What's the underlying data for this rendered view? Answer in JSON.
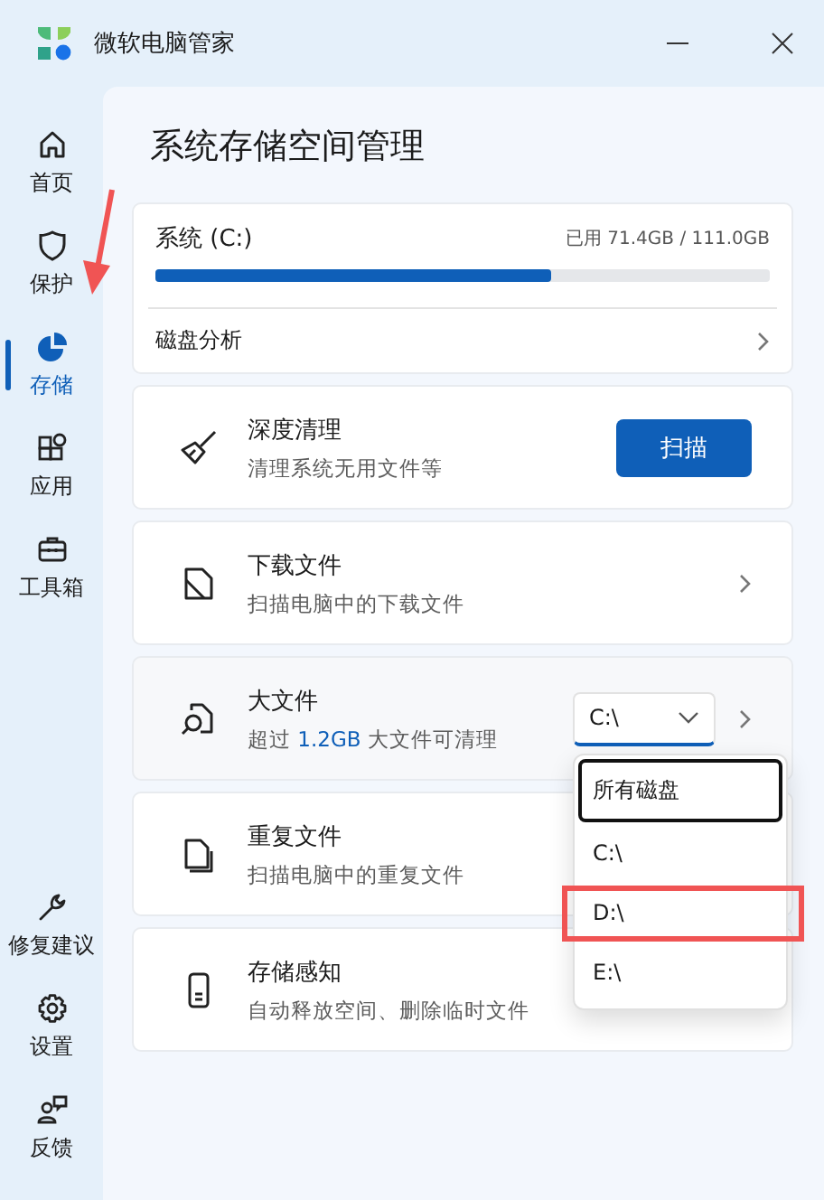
{
  "window": {
    "title": "微软电脑管家"
  },
  "sidebar": {
    "items": [
      {
        "label": "首页",
        "selected": false
      },
      {
        "label": "保护",
        "selected": false
      },
      {
        "label": "存储",
        "selected": true
      },
      {
        "label": "应用",
        "selected": false
      },
      {
        "label": "工具箱",
        "selected": false
      }
    ],
    "bottom_items": [
      {
        "label": "修复建议",
        "selected": false
      },
      {
        "label": "设置",
        "selected": false
      },
      {
        "label": "反馈",
        "selected": false
      }
    ]
  },
  "page_title": "系统存储空间管理",
  "disk": {
    "name": "系统 (C:)",
    "usage": "已用 71.4GB / 111.0GB",
    "level": 0.643,
    "link": "磁盘分析"
  },
  "cards": [
    {
      "kind": "button",
      "title": "深度清理",
      "subtitle": "清理系统无用文件等",
      "button": "扫描"
    },
    {
      "kind": "chevron",
      "title": "下载文件",
      "subtitle": "扫描电脑中的下载文件"
    },
    {
      "kind": "dropdown",
      "title": "大文件",
      "subtitle": "超过 *1.2GB* 大文件可清理",
      "value": "C:\\",
      "menu": [
        {
          "label": "所有磁盘",
          "focused": true
        },
        {
          "label": "C:\\",
          "focused": false
        },
        {
          "label": "D:\\",
          "focused": false
        },
        {
          "label": "E:\\",
          "focused": false
        }
      ]
    },
    {
      "kind": "plain",
      "title": "重复文件",
      "subtitle": "扫描电脑中的重复文件"
    },
    {
      "kind": "plain",
      "title": "存储感知",
      "subtitle": "自动释放空间、删除临时文件"
    }
  ]
}
